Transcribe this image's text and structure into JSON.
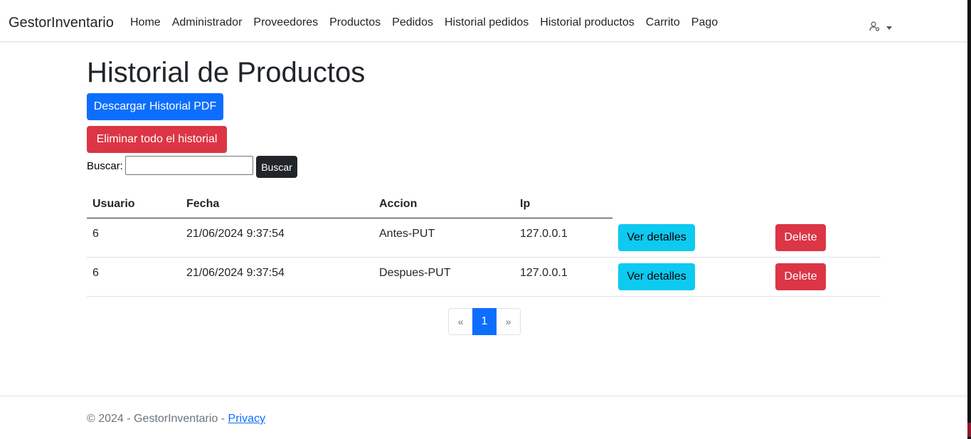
{
  "navbar": {
    "brand": "GestorInventario",
    "links": [
      "Home",
      "Administrador",
      "Proveedores",
      "Productos",
      "Pedidos",
      "Historial pedidos",
      "Historial productos",
      "Carrito",
      "Pago"
    ],
    "user_icon": "user-gear-icon"
  },
  "page": {
    "title": "Historial de Productos",
    "download_pdf_label": "Descargar Historial PDF",
    "delete_all_label": "Eliminar todo el historial",
    "search_label": "Buscar:",
    "search_value": "",
    "search_button_label": "Buscar"
  },
  "table": {
    "headers": [
      "Usuario",
      "Fecha",
      "Accion",
      "Ip"
    ],
    "rows": [
      {
        "usuario": "6",
        "fecha": "21/06/2024 9:37:54",
        "accion": "Antes-PUT",
        "ip": "127.0.0.1",
        "details_label": "Ver detalles",
        "delete_label": "Delete"
      },
      {
        "usuario": "6",
        "fecha": "21/06/2024 9:37:54",
        "accion": "Despues-PUT",
        "ip": "127.0.0.1",
        "details_label": "Ver detalles",
        "delete_label": "Delete"
      }
    ]
  },
  "pagination": {
    "prev": "«",
    "current": "1",
    "next": "»"
  },
  "footer": {
    "text": "© 2024 - GestorInventario - ",
    "privacy_link": "Privacy"
  },
  "colors": {
    "primary": "#0d6efd",
    "danger": "#dc3545",
    "info": "#0dcaf0",
    "dark": "#212529"
  }
}
